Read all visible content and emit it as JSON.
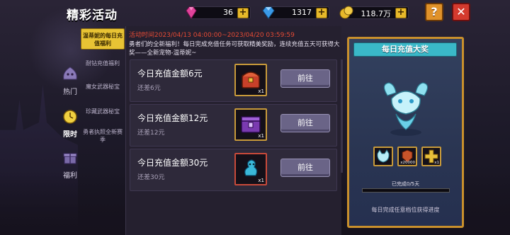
{
  "header": {
    "title": "精彩活动",
    "gems": "36",
    "diamonds": "1317",
    "gold": "118.7万",
    "help": "?",
    "close": "✕"
  },
  "main_nav": [
    {
      "label": "热门",
      "icon": "slime-icon",
      "active": false
    },
    {
      "label": "限时",
      "icon": "clock-icon",
      "active": true
    },
    {
      "label": "福利",
      "icon": "gift-icon",
      "active": false
    }
  ],
  "sub_nav": [
    {
      "label": "温蒂妮的每日充值福利",
      "active": true
    },
    {
      "label": "耐钻充值福利",
      "active": false
    },
    {
      "label": "魔女武器秘宝",
      "active": false
    },
    {
      "label": "珍藏武器秘宝",
      "active": false
    },
    {
      "label": "勇者执照全新赛季",
      "active": false
    }
  ],
  "activity": {
    "period": "活动时间2023/04/13 04:00:00~2023/04/20 03:59:59",
    "description": "勇者们的全新福利！每日完成充值任务可获取精美奖励，连续充值五天可获得大奖——全新宠物-温蒂妮~"
  },
  "tasks": [
    {
      "name": "今日充值金额6元",
      "remain": "还差6元",
      "reward_icon": "treasure-chest-icon",
      "qty": "x1",
      "button": "前往"
    },
    {
      "name": "今日充值金额12元",
      "remain": "还差12元",
      "reward_icon": "purple-chest-icon",
      "qty": "x1",
      "button": "前往"
    },
    {
      "name": "今日充值金额30元",
      "remain": "还差30元",
      "reward_icon": "spirit-pet-icon",
      "qty": "x1",
      "button": "前往"
    }
  ],
  "grand_prize": {
    "title": "每日充值大奖",
    "rewards": [
      {
        "icon": "pet-fox-icon",
        "qty": ""
      },
      {
        "icon": "material-icon",
        "qty": "x20000"
      },
      {
        "icon": "golden-cross-icon",
        "qty": "x1"
      }
    ],
    "progress_text": "已完成0/5天",
    "progress_value": 0,
    "footer": "每日完成任意档位获得进度"
  },
  "colors": {
    "gold_border": "#c9902c",
    "banner": "#3ab8c8",
    "period_red": "#e44a34"
  }
}
